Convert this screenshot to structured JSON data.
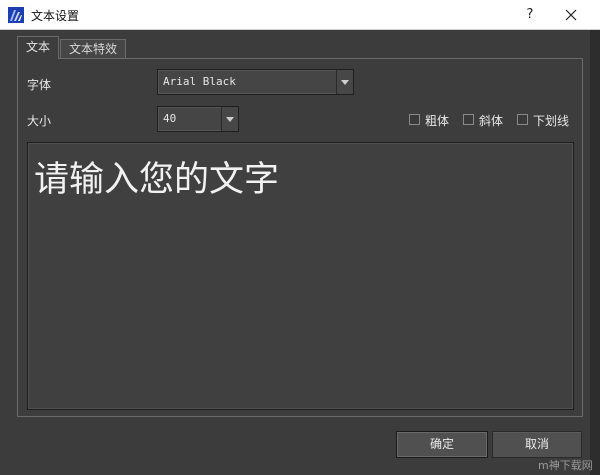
{
  "window": {
    "title": "文本设置",
    "help_glyph": "?",
    "close_glyph": "✕"
  },
  "tabs": [
    {
      "label": "文本",
      "active": true
    },
    {
      "label": "文本特效",
      "active": false
    }
  ],
  "font": {
    "label": "字体",
    "value": "Arial Black"
  },
  "size": {
    "label": "大小",
    "value": "40"
  },
  "styles": {
    "bold": {
      "label": "粗体",
      "checked": false
    },
    "italic": {
      "label": "斜体",
      "checked": false
    },
    "underline": {
      "label": "下划线",
      "checked": false
    }
  },
  "text_input": {
    "value": "请输入您的文字"
  },
  "buttons": {
    "ok_label": "确定",
    "cancel_label": "取消"
  },
  "watermark": "m神下载网",
  "colors": {
    "window_bg": "#3c3c3c",
    "titlebar_bg": "#ffffff",
    "text": "#e6e6e6",
    "border": "#6a6a6a"
  },
  "icons": {
    "app": "app-icon",
    "dropdown": "chevron-down-icon",
    "close": "close-icon",
    "help": "help-icon"
  }
}
